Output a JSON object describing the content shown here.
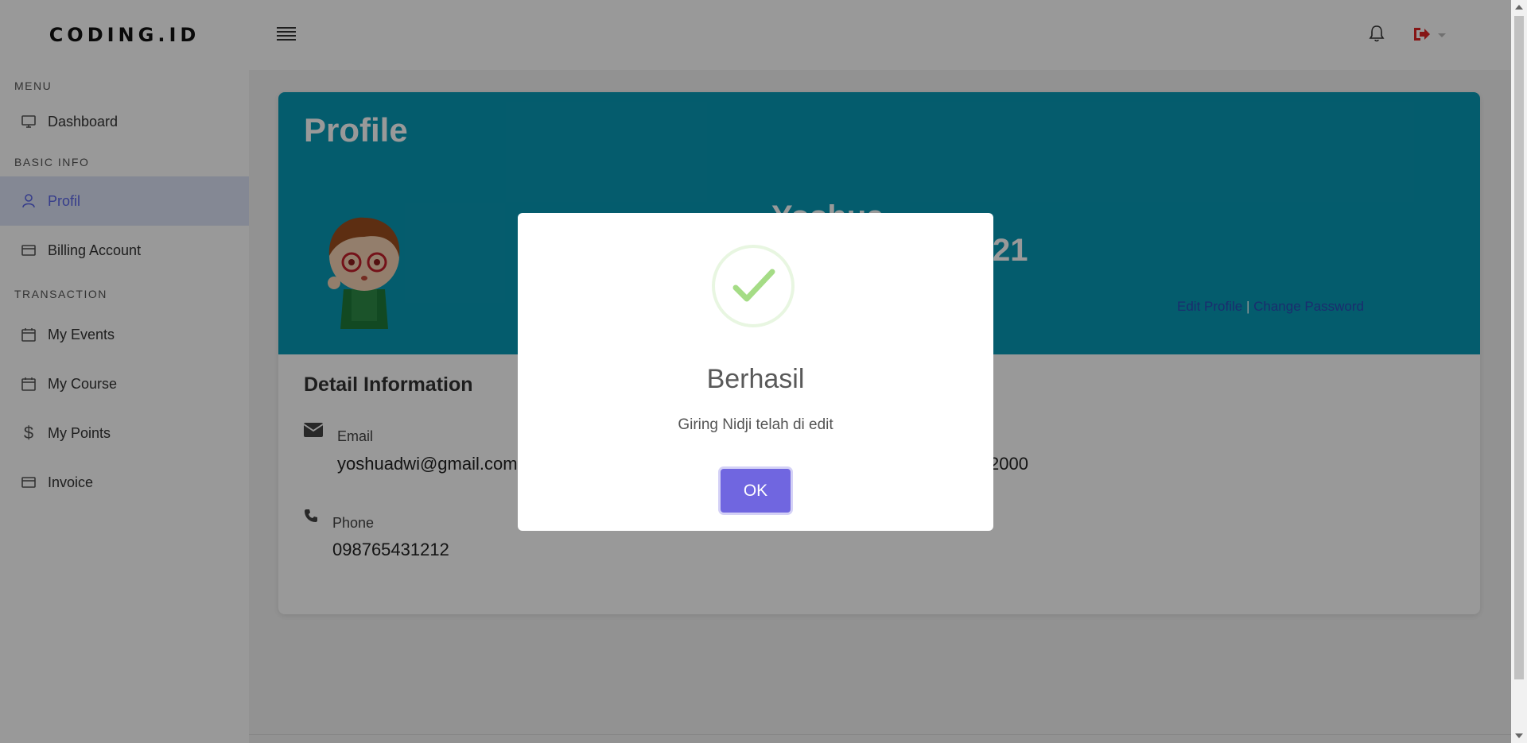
{
  "brand": "CODING.ID",
  "sidebar": {
    "sections": [
      {
        "heading": "MENU",
        "items": [
          {
            "label": "Dashboard",
            "icon": "monitor-icon"
          }
        ]
      },
      {
        "heading": "BASIC INFO",
        "items": [
          {
            "label": "Profil",
            "icon": "user-icon",
            "active": true
          },
          {
            "label": "Billing Account",
            "icon": "credit-card-icon"
          }
        ]
      },
      {
        "heading": "TRANSACTION",
        "items": [
          {
            "label": "My Events",
            "icon": "calendar-icon"
          },
          {
            "label": "My Course",
            "icon": "calendar-icon"
          },
          {
            "label": "My Points",
            "icon": "dollar-icon"
          },
          {
            "label": "Invoice",
            "icon": "credit-card-icon"
          }
        ]
      }
    ]
  },
  "topbar": {
    "icons": [
      "menu-icon",
      "bell-icon",
      "logout-icon"
    ]
  },
  "profile": {
    "title": "Profile",
    "name": "Yoshua",
    "number_fragment": "21",
    "edit_profile_label": "Edit Profile",
    "separator": "|",
    "change_password_label": "Change Password",
    "detail_title": "Detail Information",
    "email_label": "Email",
    "email_value": "yoshuadwi@gmail.com",
    "phone_label": "Phone",
    "phone_value": "098765431212",
    "partial_value": "2000"
  },
  "modal": {
    "title": "Berhasil",
    "text": "Giring Nidji telah di edit",
    "ok_label": "OK",
    "icon": "success-check-icon"
  },
  "colors": {
    "header": "#0899b6",
    "accent": "#5a66e8",
    "ok_button": "#7066e0",
    "check": "#a5dc86",
    "logout": "#e02424"
  }
}
